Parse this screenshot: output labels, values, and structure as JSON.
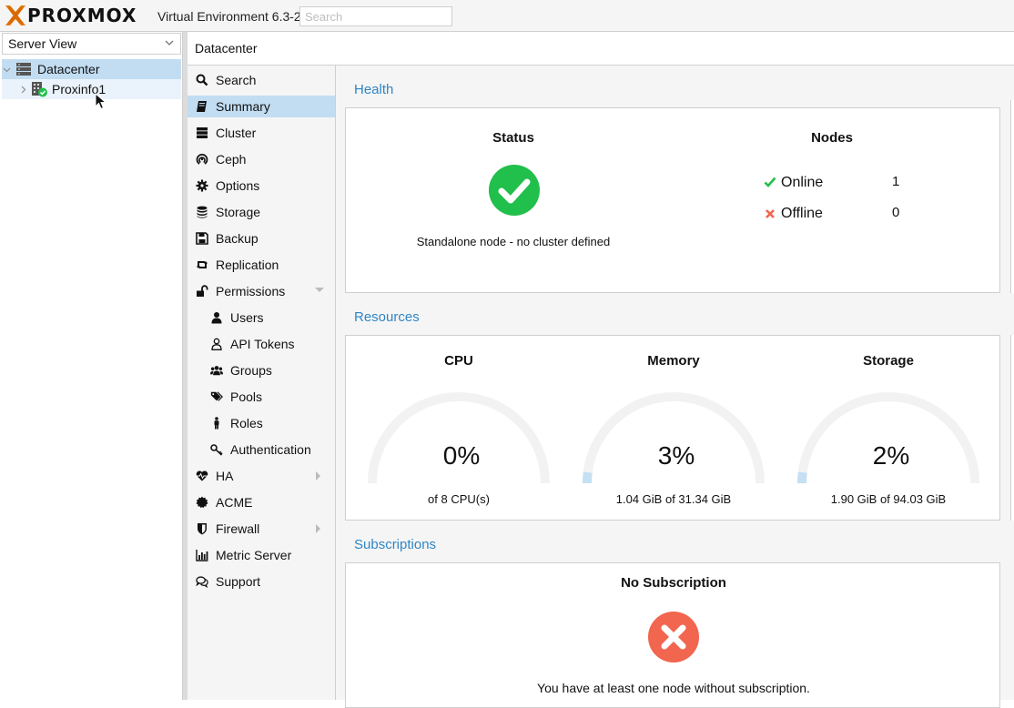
{
  "header": {
    "logo_text": "PROXMOX",
    "version": "Virtual Environment 6.3-2",
    "search_placeholder": "Search"
  },
  "tree": {
    "view_select": "Server View",
    "items": [
      {
        "label": "Datacenter",
        "icon": "server-rack-icon"
      },
      {
        "label": "Proxinfo1",
        "icon": "node-online-icon"
      }
    ]
  },
  "content": {
    "title": "Datacenter"
  },
  "nav": {
    "items": [
      {
        "label": "Search",
        "icon": "search-icon"
      },
      {
        "label": "Summary",
        "icon": "book-icon"
      },
      {
        "label": "Cluster",
        "icon": "server-icon"
      },
      {
        "label": "Ceph",
        "icon": "ceph-icon"
      },
      {
        "label": "Options",
        "icon": "gear-icon"
      },
      {
        "label": "Storage",
        "icon": "database-icon"
      },
      {
        "label": "Backup",
        "icon": "floppy-icon"
      },
      {
        "label": "Replication",
        "icon": "retweet-icon"
      },
      {
        "label": "Permissions",
        "icon": "unlock-icon"
      },
      {
        "label": "Users",
        "icon": "user-icon"
      },
      {
        "label": "API Tokens",
        "icon": "user-outline-icon"
      },
      {
        "label": "Groups",
        "icon": "users-icon"
      },
      {
        "label": "Pools",
        "icon": "tags-icon"
      },
      {
        "label": "Roles",
        "icon": "male-icon"
      },
      {
        "label": "Authentication",
        "icon": "key-icon"
      },
      {
        "label": "HA",
        "icon": "heartbeat-icon"
      },
      {
        "label": "ACME",
        "icon": "certificate-icon"
      },
      {
        "label": "Firewall",
        "icon": "shield-icon"
      },
      {
        "label": "Metric Server",
        "icon": "bar-chart-icon"
      },
      {
        "label": "Support",
        "icon": "comments-icon"
      }
    ]
  },
  "health": {
    "title": "Health",
    "status_title": "Status",
    "status_text": "Standalone node - no cluster defined",
    "nodes_title": "Nodes",
    "online_label": "Online",
    "online_count": "1",
    "offline_label": "Offline",
    "offline_count": "0"
  },
  "resources": {
    "title": "Resources",
    "gauges": [
      {
        "label": "CPU",
        "value": "0%",
        "fraction": 0.0,
        "detail": "of 8 CPU(s)"
      },
      {
        "label": "Memory",
        "value": "3%",
        "fraction": 0.03,
        "detail": "1.04 GiB of 31.34 GiB"
      },
      {
        "label": "Storage",
        "value": "2%",
        "fraction": 0.02,
        "detail": "1.90 GiB of 94.03 GiB"
      }
    ]
  },
  "subscriptions": {
    "title": "Subscriptions",
    "heading": "No Subscription",
    "text": "You have at least one node without subscription."
  },
  "colors": {
    "accent": "#2f86c6",
    "selected": "#c2ddf2",
    "ok": "#21bf4b",
    "error": "#f2654e",
    "gauge_track": "#f2f2f2",
    "gauge_fill": "#c5dff3"
  }
}
